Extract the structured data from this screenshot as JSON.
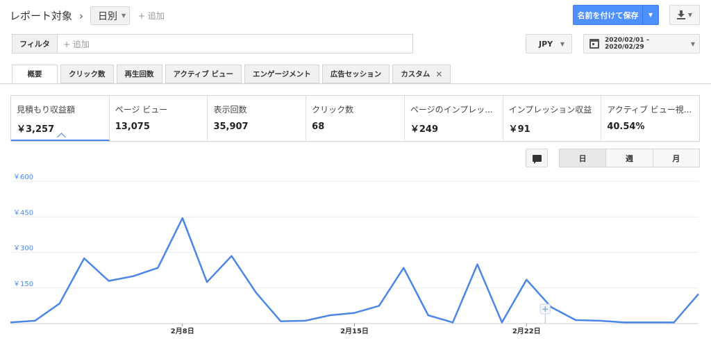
{
  "header": {
    "title": "レポート対象",
    "breadcrumb_sep": "›",
    "dimension": "日別",
    "add_label": "+ 追加",
    "save_label": "名前を付けて保存"
  },
  "filter": {
    "label": "フィルタ",
    "placeholder": "+ 追加"
  },
  "currency": "JPY",
  "date_range": "2020/02/01 – 2020/02/29",
  "tabs": [
    {
      "label": "概要"
    },
    {
      "label": "クリック数"
    },
    {
      "label": "再生回数"
    },
    {
      "label": "アクティブ ビュー"
    },
    {
      "label": "エンゲージメント"
    },
    {
      "label": "広告セッション"
    },
    {
      "label": "カスタム"
    }
  ],
  "metrics": [
    {
      "title": "見積もり収益額",
      "value": "￥3,257"
    },
    {
      "title": "ページ ビュー",
      "value": "13,075"
    },
    {
      "title": "表示回数",
      "value": "35,907"
    },
    {
      "title": "クリック数",
      "value": "68"
    },
    {
      "title": "ページのインプレッ...",
      "value": "￥249"
    },
    {
      "title": "インプレッション収益",
      "value": "￥91"
    },
    {
      "title": "アクティブ ビュー視...",
      "value": "40.54%"
    }
  ],
  "period_buttons": [
    "日",
    "週",
    "月"
  ],
  "colors": {
    "accent": "#4d90fe",
    "line": "#4a86e8"
  },
  "chart_data": {
    "type": "line",
    "x": [
      "2/1",
      "2/2",
      "2/3",
      "2/4",
      "2/5",
      "2/6",
      "2/7",
      "2/8",
      "2/9",
      "2/10",
      "2/11",
      "2/12",
      "2/13",
      "2/14",
      "2/15",
      "2/16",
      "2/17",
      "2/18",
      "2/19",
      "2/20",
      "2/21",
      "2/22",
      "2/23",
      "2/24",
      "2/25",
      "2/26",
      "2/27",
      "2/28",
      "2/29"
    ],
    "values": [
      5,
      12,
      85,
      275,
      180,
      200,
      235,
      445,
      175,
      285,
      130,
      10,
      12,
      35,
      45,
      75,
      235,
      35,
      5,
      250,
      5,
      185,
      70,
      15,
      12,
      5,
      5,
      5,
      125
    ],
    "x_tick_labels": [
      {
        "index": 7,
        "label": "2月8日"
      },
      {
        "index": 14,
        "label": "2月15日"
      },
      {
        "index": 21,
        "label": "2月22日"
      }
    ],
    "y_ticks": [
      "￥600",
      "￥450",
      "￥300",
      "￥150"
    ],
    "ylim": [
      0,
      600
    ]
  }
}
